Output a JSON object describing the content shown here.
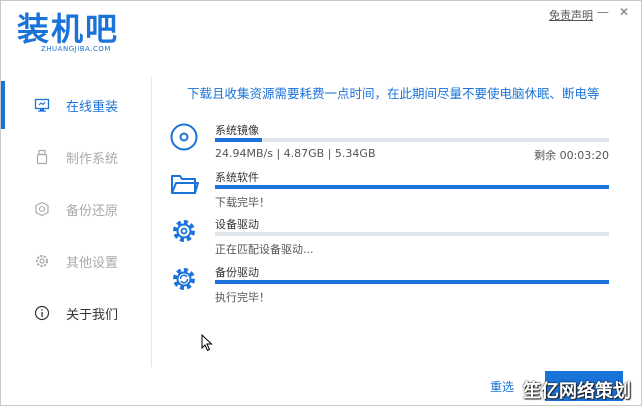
{
  "app": {
    "logo_text": "装机吧",
    "logo_sub": "ZHUANGJIBA.COM",
    "disclaimer": "免责声明",
    "minimize_glyph": "—",
    "close_glyph": "✕"
  },
  "sidebar": {
    "items": [
      {
        "label": "在线重装",
        "icon": "monitor-icon",
        "active": true
      },
      {
        "label": "制作系统",
        "icon": "usb-icon",
        "active": false
      },
      {
        "label": "备份还原",
        "icon": "backup-icon",
        "active": false
      },
      {
        "label": "其他设置",
        "icon": "gear-icon",
        "active": false
      },
      {
        "label": "关于我们",
        "icon": "info-icon",
        "active": false
      }
    ]
  },
  "notice": "下载且收集资源需要耗费一点时间，在此期间尽量不要使电脑休眠、断电等",
  "tasks": [
    {
      "name": "系统镜像",
      "status": "24.94MB/s | 4.87GB | 5.34GB",
      "remaining": "剩余 00:03:20",
      "progress": 0.12,
      "icon": "disc-icon"
    },
    {
      "name": "系统软件",
      "status": "下载完毕！",
      "remaining": "",
      "progress": 1.0,
      "icon": "folder-icon"
    },
    {
      "name": "设备驱动",
      "status": "正在匹配设备驱动...",
      "remaining": "",
      "progress": 0.0,
      "icon": "gear-icon"
    },
    {
      "name": "备份驱动",
      "status": "执行完毕！",
      "remaining": "",
      "progress": 1.0,
      "icon": "refresh-gear-icon"
    }
  ],
  "footer": {
    "link_label": "重选",
    "watermark": "笙亿网络策划"
  },
  "colors": {
    "accent": "#1a73d9",
    "track": "#e1e6ec"
  }
}
